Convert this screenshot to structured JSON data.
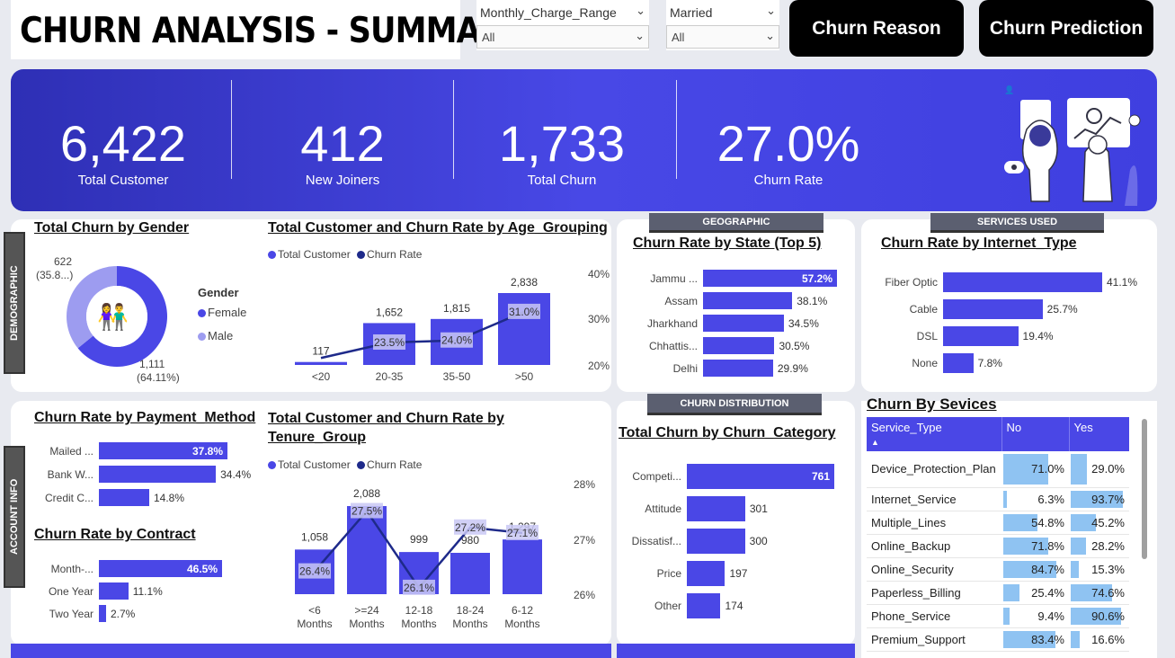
{
  "header": {
    "title": "CHURN ANALYSIS - SUMMARY",
    "slicers": [
      {
        "label": "Monthly_Charge_Range",
        "value": "All"
      },
      {
        "label": "Married",
        "value": "All"
      }
    ],
    "buttons": [
      "Churn Reason",
      "Churn Prediction"
    ]
  },
  "kpis": [
    {
      "value": "6,422",
      "label": "Total Customer"
    },
    {
      "value": "412",
      "label": "New Joiners"
    },
    {
      "value": "1,733",
      "label": "Total Churn"
    },
    {
      "value": "27.0%",
      "label": "Churn Rate"
    }
  ],
  "section_tags": {
    "demographic": "DEMOGRAPHIC",
    "account_info": "ACCOUNT INFO",
    "geographic": "GEOGRAPHIC",
    "services_used": "SERVICES USED",
    "churn_distribution": "CHURN DISTRIBUTION"
  },
  "gender": {
    "title": "Total Churn by Gender",
    "legend_title": "Gender",
    "legend": [
      "Female",
      "Male"
    ],
    "female_label": "1,111",
    "female_pct": "(64.11%)",
    "male_label": "622",
    "male_pct": "(35.8...)"
  },
  "age_chart": {
    "title": "Total Customer and Churn Rate by Age_Grouping",
    "legend": [
      "Total Customer",
      "Churn Rate"
    ],
    "right_ticks": [
      "40%",
      "30%",
      "20%"
    ]
  },
  "tenure_chart": {
    "title_line1": "Total Customer and Churn Rate by",
    "title_line2": "Tenure_Group",
    "legend": [
      "Total Customer",
      "Churn Rate"
    ],
    "right_ticks": [
      "28%",
      "27%",
      "26%"
    ]
  },
  "payment": {
    "title": "Churn Rate by Payment_Method"
  },
  "contract": {
    "title": "Churn Rate by Contract"
  },
  "state": {
    "title": "Churn Rate by State (Top 5)"
  },
  "internet": {
    "title": "Churn Rate by Internet_Type"
  },
  "category": {
    "title": "Total Churn by Churn_Category"
  },
  "services": {
    "title": "Churn By Sevices",
    "columns": [
      "Service_Type",
      "No",
      "Yes"
    ],
    "rows": [
      {
        "service": "Device_Protection_Plan",
        "no": "71.0%",
        "yes": "29.0%",
        "no_v": 71.0,
        "yes_v": 29.0
      },
      {
        "service": "Internet_Service",
        "no": "6.3%",
        "yes": "93.7%",
        "no_v": 6.3,
        "yes_v": 93.7
      },
      {
        "service": "Multiple_Lines",
        "no": "54.8%",
        "yes": "45.2%",
        "no_v": 54.8,
        "yes_v": 45.2
      },
      {
        "service": "Online_Backup",
        "no": "71.8%",
        "yes": "28.2%",
        "no_v": 71.8,
        "yes_v": 28.2
      },
      {
        "service": "Online_Security",
        "no": "84.7%",
        "yes": "15.3%",
        "no_v": 84.7,
        "yes_v": 15.3
      },
      {
        "service": "Paperless_Billing",
        "no": "25.4%",
        "yes": "74.6%",
        "no_v": 25.4,
        "yes_v": 74.6
      },
      {
        "service": "Phone_Service",
        "no": "9.4%",
        "yes": "90.6%",
        "no_v": 9.4,
        "yes_v": 90.6
      },
      {
        "service": "Premium_Support",
        "no": "83.4%",
        "yes": "16.6%",
        "no_v": 83.4,
        "yes_v": 16.6
      }
    ]
  },
  "colors": {
    "accent": "#4a47e6",
    "dark_line": "#1e2a8a",
    "light_bar": "#8fc3f2",
    "male": "#9d9cf0"
  },
  "chart_data": [
    {
      "type": "bar",
      "id": "age",
      "categories": [
        "<20",
        "20-35",
        "35-50",
        ">50"
      ],
      "series": [
        {
          "name": "Total Customer",
          "values": [
            117,
            1652,
            1815,
            2838
          ],
          "labels": [
            "117",
            "1,652",
            "1,815",
            "2,838"
          ]
        },
        {
          "name": "Churn Rate",
          "values": [
            19.7,
            23.5,
            24.0,
            31.0
          ],
          "labels": [
            "",
            "23.5%",
            "24.0%",
            "31.0%"
          ]
        }
      ]
    },
    {
      "type": "bar",
      "id": "tenure",
      "categories": [
        "<6 Months",
        ">=24 Months",
        "12-18 Months",
        "18-24 Months",
        "6-12 Months"
      ],
      "series": [
        {
          "name": "Total Customer",
          "values": [
            1058,
            2088,
            999,
            980,
            1297
          ],
          "labels": [
            "1,058",
            "2,088",
            "999",
            "980",
            "1,297"
          ]
        },
        {
          "name": "Churn Rate",
          "values": [
            26.4,
            27.5,
            26.1,
            27.2,
            27.1
          ],
          "labels": [
            "26.4%",
            "27.5%",
            "26.1%",
            "27.2%",
            "27.1%"
          ]
        }
      ]
    },
    {
      "type": "bar",
      "id": "payment",
      "categories": [
        "Mailed ...",
        "Bank W...",
        "Credit C..."
      ],
      "values": [
        37.8,
        34.4,
        14.8
      ],
      "labels": [
        "37.8%",
        "34.4%",
        "14.8%"
      ]
    },
    {
      "type": "bar",
      "id": "contract",
      "categories": [
        "Month-...",
        "One Year",
        "Two Year"
      ],
      "values": [
        46.5,
        11.1,
        2.7
      ],
      "labels": [
        "46.5%",
        "11.1%",
        "2.7%"
      ]
    },
    {
      "type": "bar",
      "id": "state",
      "categories": [
        "Jammu ...",
        "Assam",
        "Jharkhand",
        "Chhattis...",
        "Delhi"
      ],
      "values": [
        57.2,
        38.1,
        34.5,
        30.5,
        29.9
      ],
      "labels": [
        "57.2%",
        "38.1%",
        "34.5%",
        "30.5%",
        "29.9%"
      ]
    },
    {
      "type": "bar",
      "id": "internet",
      "categories": [
        "Fiber Optic",
        "Cable",
        "DSL",
        "None"
      ],
      "values": [
        41.1,
        25.7,
        19.4,
        7.8
      ],
      "labels": [
        "41.1%",
        "25.7%",
        "19.4%",
        "7.8%"
      ]
    },
    {
      "type": "bar",
      "id": "category",
      "categories": [
        "Competi...",
        "Attitude",
        "Dissatisf...",
        "Price",
        "Other"
      ],
      "values": [
        761,
        301,
        300,
        197,
        174
      ],
      "labels": [
        "761",
        "301",
        "300",
        "197",
        "174"
      ]
    },
    {
      "type": "pie",
      "id": "gender",
      "categories": [
        "Female",
        "Male"
      ],
      "values": [
        1111,
        622
      ]
    }
  ]
}
